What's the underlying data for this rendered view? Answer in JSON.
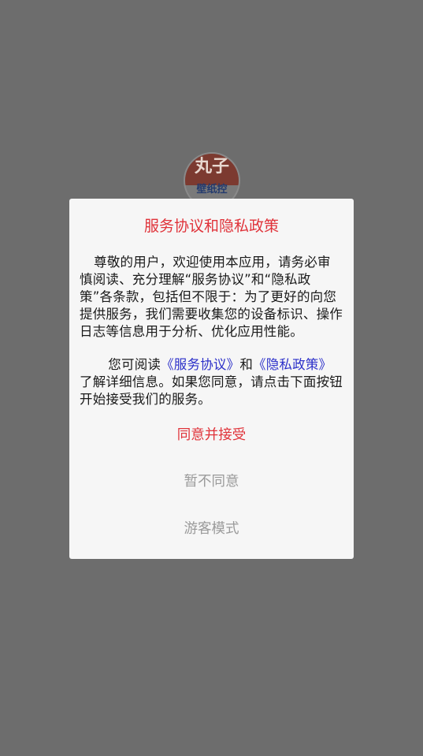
{
  "logo": {
    "main_text": "丸子",
    "sub_text": "壁纸控"
  },
  "dialog": {
    "title": "服务协议和隐私政策",
    "paragraph1": "尊敬的用户，欢迎使用本应用，请务必审慎阅读、充分理解“服务协议”和“隐私政策”各条款，包括但不限于：为了更好的向您提供服务，我们需要收集您的设备标识、操作日志等信息用于分析、优化应用性能。",
    "paragraph2_prefix": "您可阅读",
    "service_link": "《服务协议》",
    "paragraph2_and": "和",
    "privacy_link": "《隐私政策》",
    "paragraph2_suffix": "了解详细信息。如果您同意，请点击下面按钮开始接受我们的服务。",
    "agree_label": "同意并接受",
    "disagree_label": "暂不同意",
    "guest_label": "游客模式"
  },
  "colors": {
    "overlay": "#6d6d6d",
    "dialog_bg": "#f6f6f6",
    "accent_red": "#e0333a",
    "link_blue": "#2b2fc9",
    "muted_gray": "#9a9a9a"
  }
}
